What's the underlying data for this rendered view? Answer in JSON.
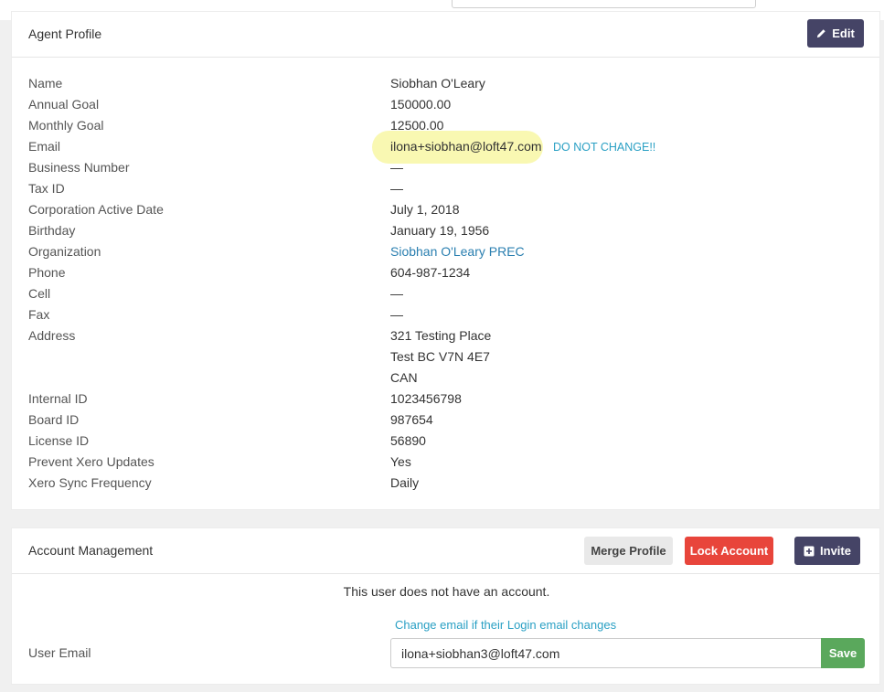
{
  "profile": {
    "title": "Agent Profile",
    "edit_label": "Edit",
    "fields": [
      {
        "label": "Name",
        "value": "Siobhan O'Leary"
      },
      {
        "label": "Annual Goal",
        "value": "150000.00"
      },
      {
        "label": "Monthly Goal",
        "value": "12500.00"
      },
      {
        "label": "Email",
        "value": "ilona+siobhan@loft47.com"
      },
      {
        "label": "Business Number",
        "value": "—"
      },
      {
        "label": "Tax ID",
        "value": "—"
      },
      {
        "label": "Corporation Active Date",
        "value": "July 1, 2018"
      },
      {
        "label": "Birthday",
        "value": "January 19, 1956"
      },
      {
        "label": "Organization",
        "value": "Siobhan O'Leary PREC"
      },
      {
        "label": "Phone",
        "value": "604-987-1234"
      },
      {
        "label": "Cell",
        "value": "—"
      },
      {
        "label": "Fax",
        "value": "—"
      },
      {
        "label": "Address",
        "value": "321 Testing Place"
      },
      {
        "label": "",
        "value": "Test BC V7N 4E7"
      },
      {
        "label": "",
        "value": "CAN"
      },
      {
        "label": "Internal ID",
        "value": "1023456798"
      },
      {
        "label": "Board ID",
        "value": "987654"
      },
      {
        "label": "License ID",
        "value": "56890"
      },
      {
        "label": "Prevent Xero Updates",
        "value": "Yes"
      },
      {
        "label": "Xero Sync Frequency",
        "value": "Daily"
      }
    ],
    "email_note": "DO NOT CHANGE!!"
  },
  "account": {
    "title": "Account Management",
    "merge_label": "Merge Profile",
    "lock_label": "Lock Account",
    "invite_label": "Invite",
    "no_account_text": "This user does not have an account.",
    "change_note": "Change email if their Login email changes",
    "user_email_label": "User Email",
    "user_email_value": "ilona+siobhan3@loft47.com",
    "save_label": "Save"
  },
  "colors": {
    "primary_dark": "#454466",
    "danger": "#e8453b",
    "success": "#5aa85c",
    "link": "#2a7fb0",
    "highlight": "#f8f7a4"
  },
  "icons": {
    "edit": "pencil-icon",
    "invite": "plus-square-icon"
  }
}
